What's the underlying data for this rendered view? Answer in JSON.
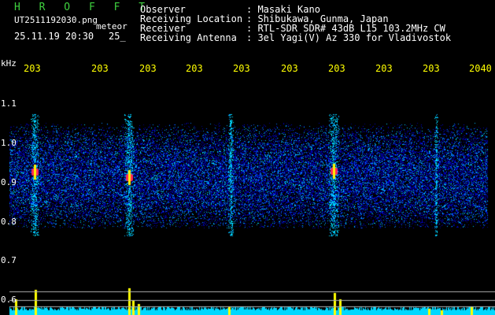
{
  "app": {
    "title": "H R O F F T",
    "filename": "UT2511192030.png",
    "meteor_label": "meteor",
    "datetime": "25.11.19 20:30",
    "count": "25_"
  },
  "info": [
    {
      "label": "Observer",
      "value": ": Masaki Kano"
    },
    {
      "label": "Receiving Location",
      "value": ": Shibukawa, Gunma, Japan"
    },
    {
      "label": "Receiver",
      "value": ": RTL-SDR SDR# 43dB L15 103.2MHz CW"
    },
    {
      "label": "Receiving Antenna",
      "value": ": 3el Yagi(V) Az 330 for Vladivostok"
    }
  ],
  "axis": {
    "unit": "kHz",
    "x_ticks": [
      "203",
      "203",
      "203",
      "203",
      "203",
      "203",
      "203",
      "203",
      "203",
      "2040"
    ],
    "y_ticks": [
      "1.1",
      "1.0",
      "0.9",
      "0.8",
      "0.7",
      "0.6"
    ]
  },
  "colors": {
    "title": "#3fd13f",
    "tick_labels": "#ffff00",
    "background": "#000000",
    "baseline": "#00ffff",
    "spikes": "#ffff00"
  }
}
